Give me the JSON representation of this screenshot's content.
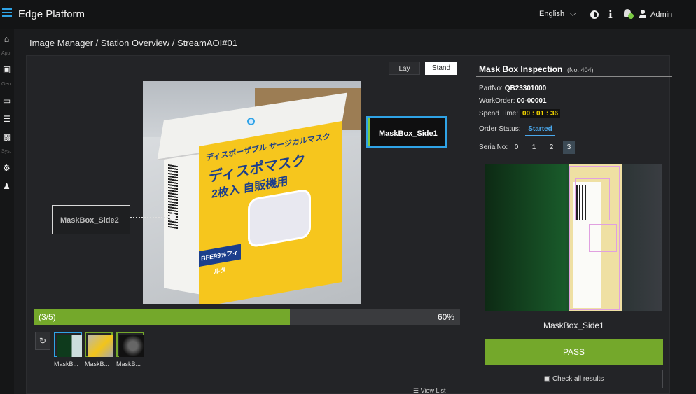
{
  "header": {
    "app_title": "Edge Platform",
    "language": "English",
    "user": "Admin",
    "icons": [
      "menu-icon",
      "chevron-down-icon",
      "contrast-icon",
      "info-icon",
      "notification-bell-icon",
      "user-icon"
    ]
  },
  "sidebar": {
    "items": [
      {
        "icon": "home-icon",
        "label": "App."
      },
      {
        "icon": "image-icon",
        "label": "Gen"
      },
      {
        "icon": "monitor-icon",
        "label": ""
      },
      {
        "icon": "list-icon",
        "label": ""
      },
      {
        "icon": "bar-chart-icon",
        "label": "Sys."
      },
      {
        "icon": "gear-icon",
        "label": ""
      },
      {
        "icon": "person-icon",
        "label": ""
      }
    ]
  },
  "breadcrumb": "Image Manager / Station Overview / StreamAOI#01",
  "view_toggle": {
    "lay": "Lay",
    "stand": "Stand",
    "selected": "Stand"
  },
  "photo": {
    "box_text_1": "ディスポーザブル サージカルマスク",
    "box_text_2": "ディスポマスク",
    "box_text_3": "2枚入 自販機用",
    "box_badge": "BFE99%フィルタ"
  },
  "callouts": {
    "side1": "MaskBox_Side1",
    "side2": "MaskBox_Side2"
  },
  "progress": {
    "count_label": "(3/5)",
    "percent_label": "60%",
    "value": 0.6
  },
  "thumbnails": [
    {
      "label": "MaskB...",
      "selected": true
    },
    {
      "label": "MaskB...",
      "selected": false
    },
    {
      "label": "MaskB...",
      "selected": false
    }
  ],
  "view_list": "View List",
  "inspection": {
    "title": "Mask Box Inspection",
    "number": "(No. 404)",
    "part_no_label": "PartNo:",
    "part_no": "QB23301000",
    "work_order_label": "WorkOrder:",
    "work_order": "00-00001",
    "spend_time_label": "Spend Time:",
    "spend_time": "00 : 01 : 36",
    "order_status_label": "Order Status:",
    "order_status": "Started",
    "serial_label": "SerialNo:",
    "serials": [
      "0",
      "1",
      "2",
      "3"
    ],
    "serial_selected": "3",
    "image_label": "MaskBox_Side1",
    "result": "PASS",
    "check_all": "Check all results"
  },
  "colors": {
    "accent_blue": "#2fa3e6",
    "pass_green": "#74a82b",
    "time_yellow": "#f2d400"
  }
}
